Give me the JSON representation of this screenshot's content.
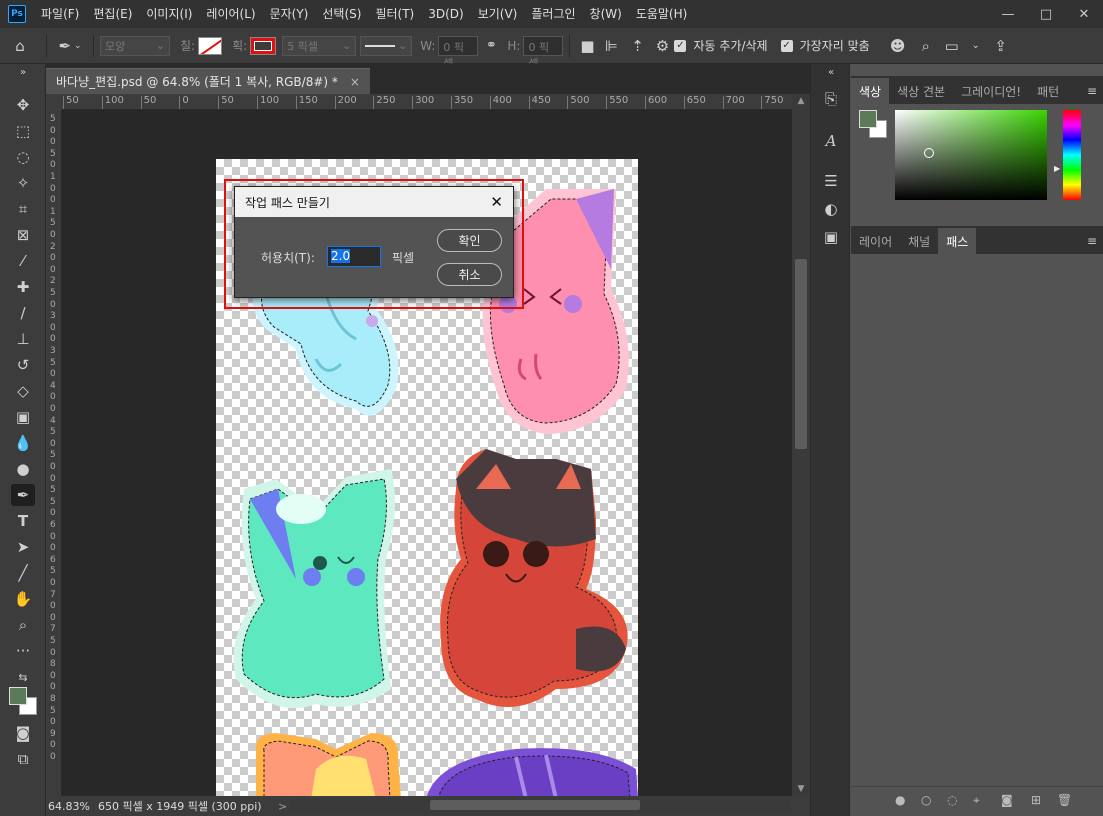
{
  "menubar": {
    "logo": "Ps",
    "items": [
      "파일(F)",
      "편집(E)",
      "이미지(I)",
      "레이어(L)",
      "문자(Y)",
      "선택(S)",
      "필터(T)",
      "3D(D)",
      "보기(V)",
      "플러그인",
      "창(W)",
      "도움말(H)"
    ],
    "window_controls": [
      "—",
      "□",
      "✕"
    ]
  },
  "options": {
    "mode_select": "모양",
    "fill_label": "칠:",
    "stroke_label": "획:",
    "stroke_width": "5 픽셀",
    "w_label": "W:",
    "w_value": "0 픽셀",
    "h_label": "H:",
    "h_value": "0 픽셀",
    "auto_add_delete": "자동 추가/삭제",
    "align_edges": "가장자리 맞춤"
  },
  "document": {
    "tab_title": "바다냥_편집.psd @ 64.8% (폴더 1 복사, RGB/8#) *",
    "close": "×"
  },
  "ruler": {
    "top_ticks": [
      "50",
      "100",
      "50",
      "0",
      "50",
      "100",
      "150",
      "200",
      "250",
      "300",
      "350",
      "400",
      "450",
      "500",
      "550",
      "600",
      "650",
      "700",
      "750"
    ],
    "left_ticks": [
      "5",
      "0",
      "0",
      "5",
      "0",
      "1",
      "0",
      "0",
      "1",
      "5",
      "0",
      "2",
      "0",
      "0",
      "2",
      "5",
      "0",
      "3",
      "0",
      "0",
      "3",
      "5",
      "0",
      "4",
      "0",
      "0",
      "4",
      "5",
      "0",
      "5",
      "0",
      "0",
      "5",
      "5",
      "0",
      "6",
      "0",
      "0",
      "6",
      "5",
      "0",
      "7",
      "0",
      "0",
      "7",
      "5",
      "0",
      "8",
      "0",
      "0",
      "8",
      "5",
      "0",
      "9",
      "0",
      "0"
    ]
  },
  "status": {
    "zoom": "64.83%",
    "info": "650 픽셀 x 1949 픽셀 (300 ppi)",
    "arrow_right": ">"
  },
  "color_panel": {
    "tabs": [
      "색상",
      "색상 견본",
      "그레이디언!",
      "패턴"
    ],
    "foreground": "#5b7a58",
    "background": "#ffffff"
  },
  "layers_panel": {
    "tabs": [
      "레이어",
      "채널",
      "패스"
    ]
  },
  "dialog": {
    "title": "작업 패스 만들기",
    "tolerance_label": "허용치(T):",
    "tolerance_value": "2.0",
    "unit": "픽셀",
    "ok": "확인",
    "cancel": "취소"
  },
  "colors": {
    "accent": "#1473e6",
    "highlight": "#e01010"
  }
}
